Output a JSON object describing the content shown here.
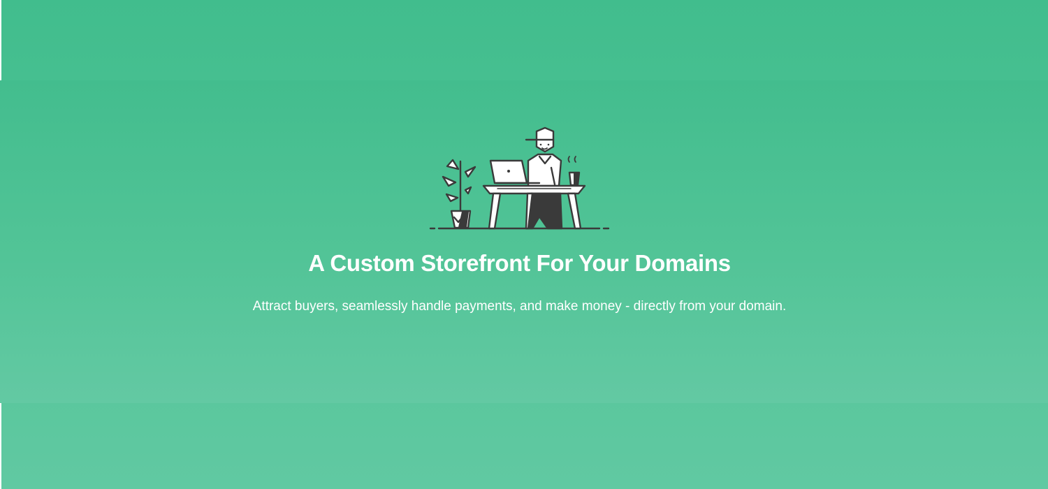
{
  "hero": {
    "title": "A Custom Storefront For Your Domains",
    "subtitle": "Attract buyers, seamlessly handle payments, and make money - directly from your domain.",
    "illustration_icon": "person-at-desk-with-laptop-illustration"
  },
  "colors": {
    "background_top": "#41bd8d",
    "background_bottom": "#61c9a2",
    "text": "#ffffff",
    "illustration_stroke": "#3a3a3a"
  }
}
